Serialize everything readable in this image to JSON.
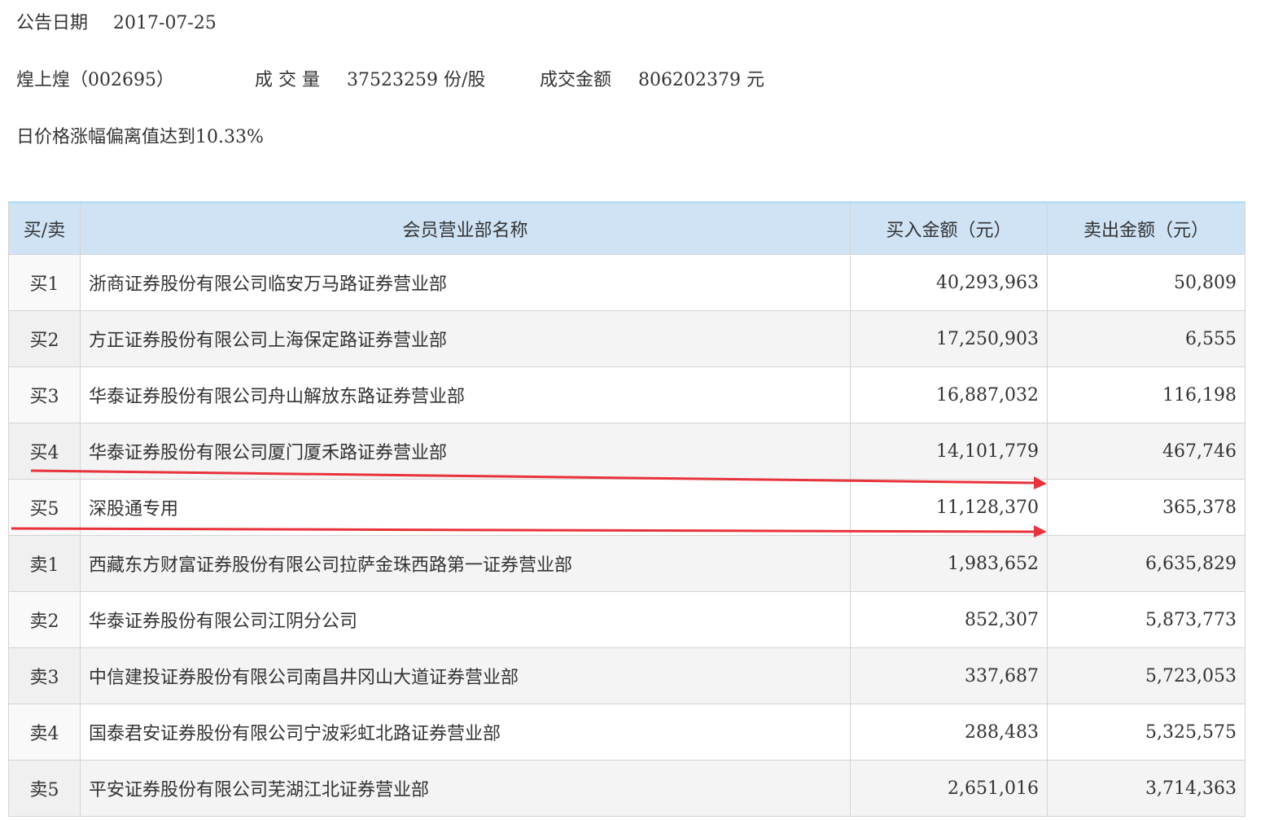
{
  "header": {
    "date_label": "公告日期",
    "date_value": "2017-07-25",
    "stock_name": "煌上煌（002695）",
    "volume_label": "成 交 量",
    "volume_value": "37523259 份/股",
    "amount_label": "成交金额",
    "amount_value": "806202379 元",
    "reason": "日价格涨幅偏离值达到10.33%"
  },
  "table": {
    "headers": [
      "买/卖",
      "会员营业部名称",
      "买入金额（元）",
      "卖出金额（元）"
    ],
    "rows": [
      {
        "side": "买1",
        "name": "浙商证券股份有限公司临安万马路证券营业部",
        "buy": "40,293,963",
        "sell": "50,809"
      },
      {
        "side": "买2",
        "name": "方正证券股份有限公司上海保定路证券营业部",
        "buy": "17,250,903",
        "sell": "6,555"
      },
      {
        "side": "买3",
        "name": "华泰证券股份有限公司舟山解放东路证券营业部",
        "buy": "16,887,032",
        "sell": "116,198"
      },
      {
        "side": "买4",
        "name": "华泰证券股份有限公司厦门厦禾路证券营业部",
        "buy": "14,101,779",
        "sell": "467,746"
      },
      {
        "side": "买5",
        "name": "深股通专用",
        "buy": "11,128,370",
        "sell": "365,378"
      },
      {
        "side": "卖1",
        "name": "西藏东方财富证券股份有限公司拉萨金珠西路第一证券营业部",
        "buy": "1,983,652",
        "sell": "6,635,829"
      },
      {
        "side": "卖2",
        "name": "华泰证券股份有限公司江阴分公司",
        "buy": "852,307",
        "sell": "5,873,773"
      },
      {
        "side": "卖3",
        "name": "中信建投证券股份有限公司南昌井冈山大道证券营业部",
        "buy": "337,687",
        "sell": "5,723,053"
      },
      {
        "side": "卖4",
        "name": "国泰君安证券股份有限公司宁波彩虹北路证券营业部",
        "buy": "288,483",
        "sell": "5,325,575"
      },
      {
        "side": "卖5",
        "name": "平安证券股份有限公司芜湖江北证券营业部",
        "buy": "2,651,016",
        "sell": "3,714,363"
      }
    ]
  },
  "annotations": {
    "arrow_color": "#e8323c"
  }
}
